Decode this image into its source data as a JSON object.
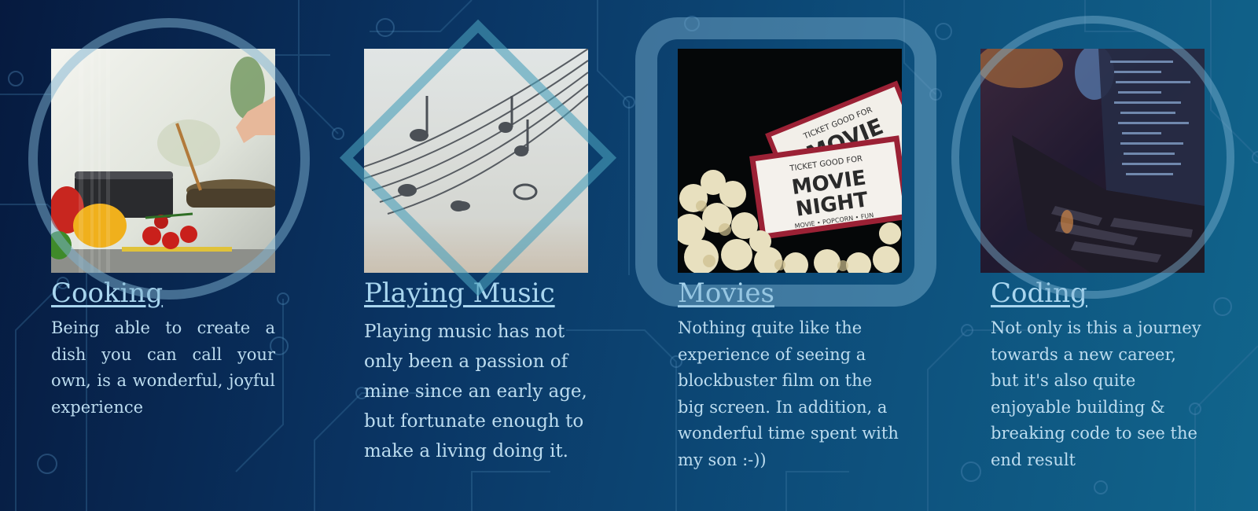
{
  "cards": [
    {
      "title": "Cooking",
      "description": "Being able to create a dish you can call your own, is a wonderful, joyful experience",
      "image_icon": "cooking-photo"
    },
    {
      "title": "Playing Music",
      "description": "Playing music has not only been a passion of mine since an early age, but fortunate enough to make a living doing it.",
      "image_icon": "sheet-music-photo"
    },
    {
      "title": "Movies",
      "description": "Nothing quite like the experience of seeing a blockbuster film on the big screen. In addition, a wonderful time spent with my son :-))",
      "image_icon": "movie-night-photo",
      "ticket_text_top": "TICKET GOOD FOR",
      "ticket_text_main_1": "MOVIE",
      "ticket_text_main_2": "NIGHT",
      "ticket_text_bottom": "MOVIE • POPCORN • FUN"
    },
    {
      "title": "Coding",
      "description": "Not only is this a journey towards a new career, but it's also quite enjoyable building & breaking code to see the end result",
      "image_icon": "laptop-code-photo"
    }
  ],
  "colors": {
    "link": "#a9d6ef",
    "text": "#bcdcef",
    "overlay_shape": "#7fb4d2"
  }
}
